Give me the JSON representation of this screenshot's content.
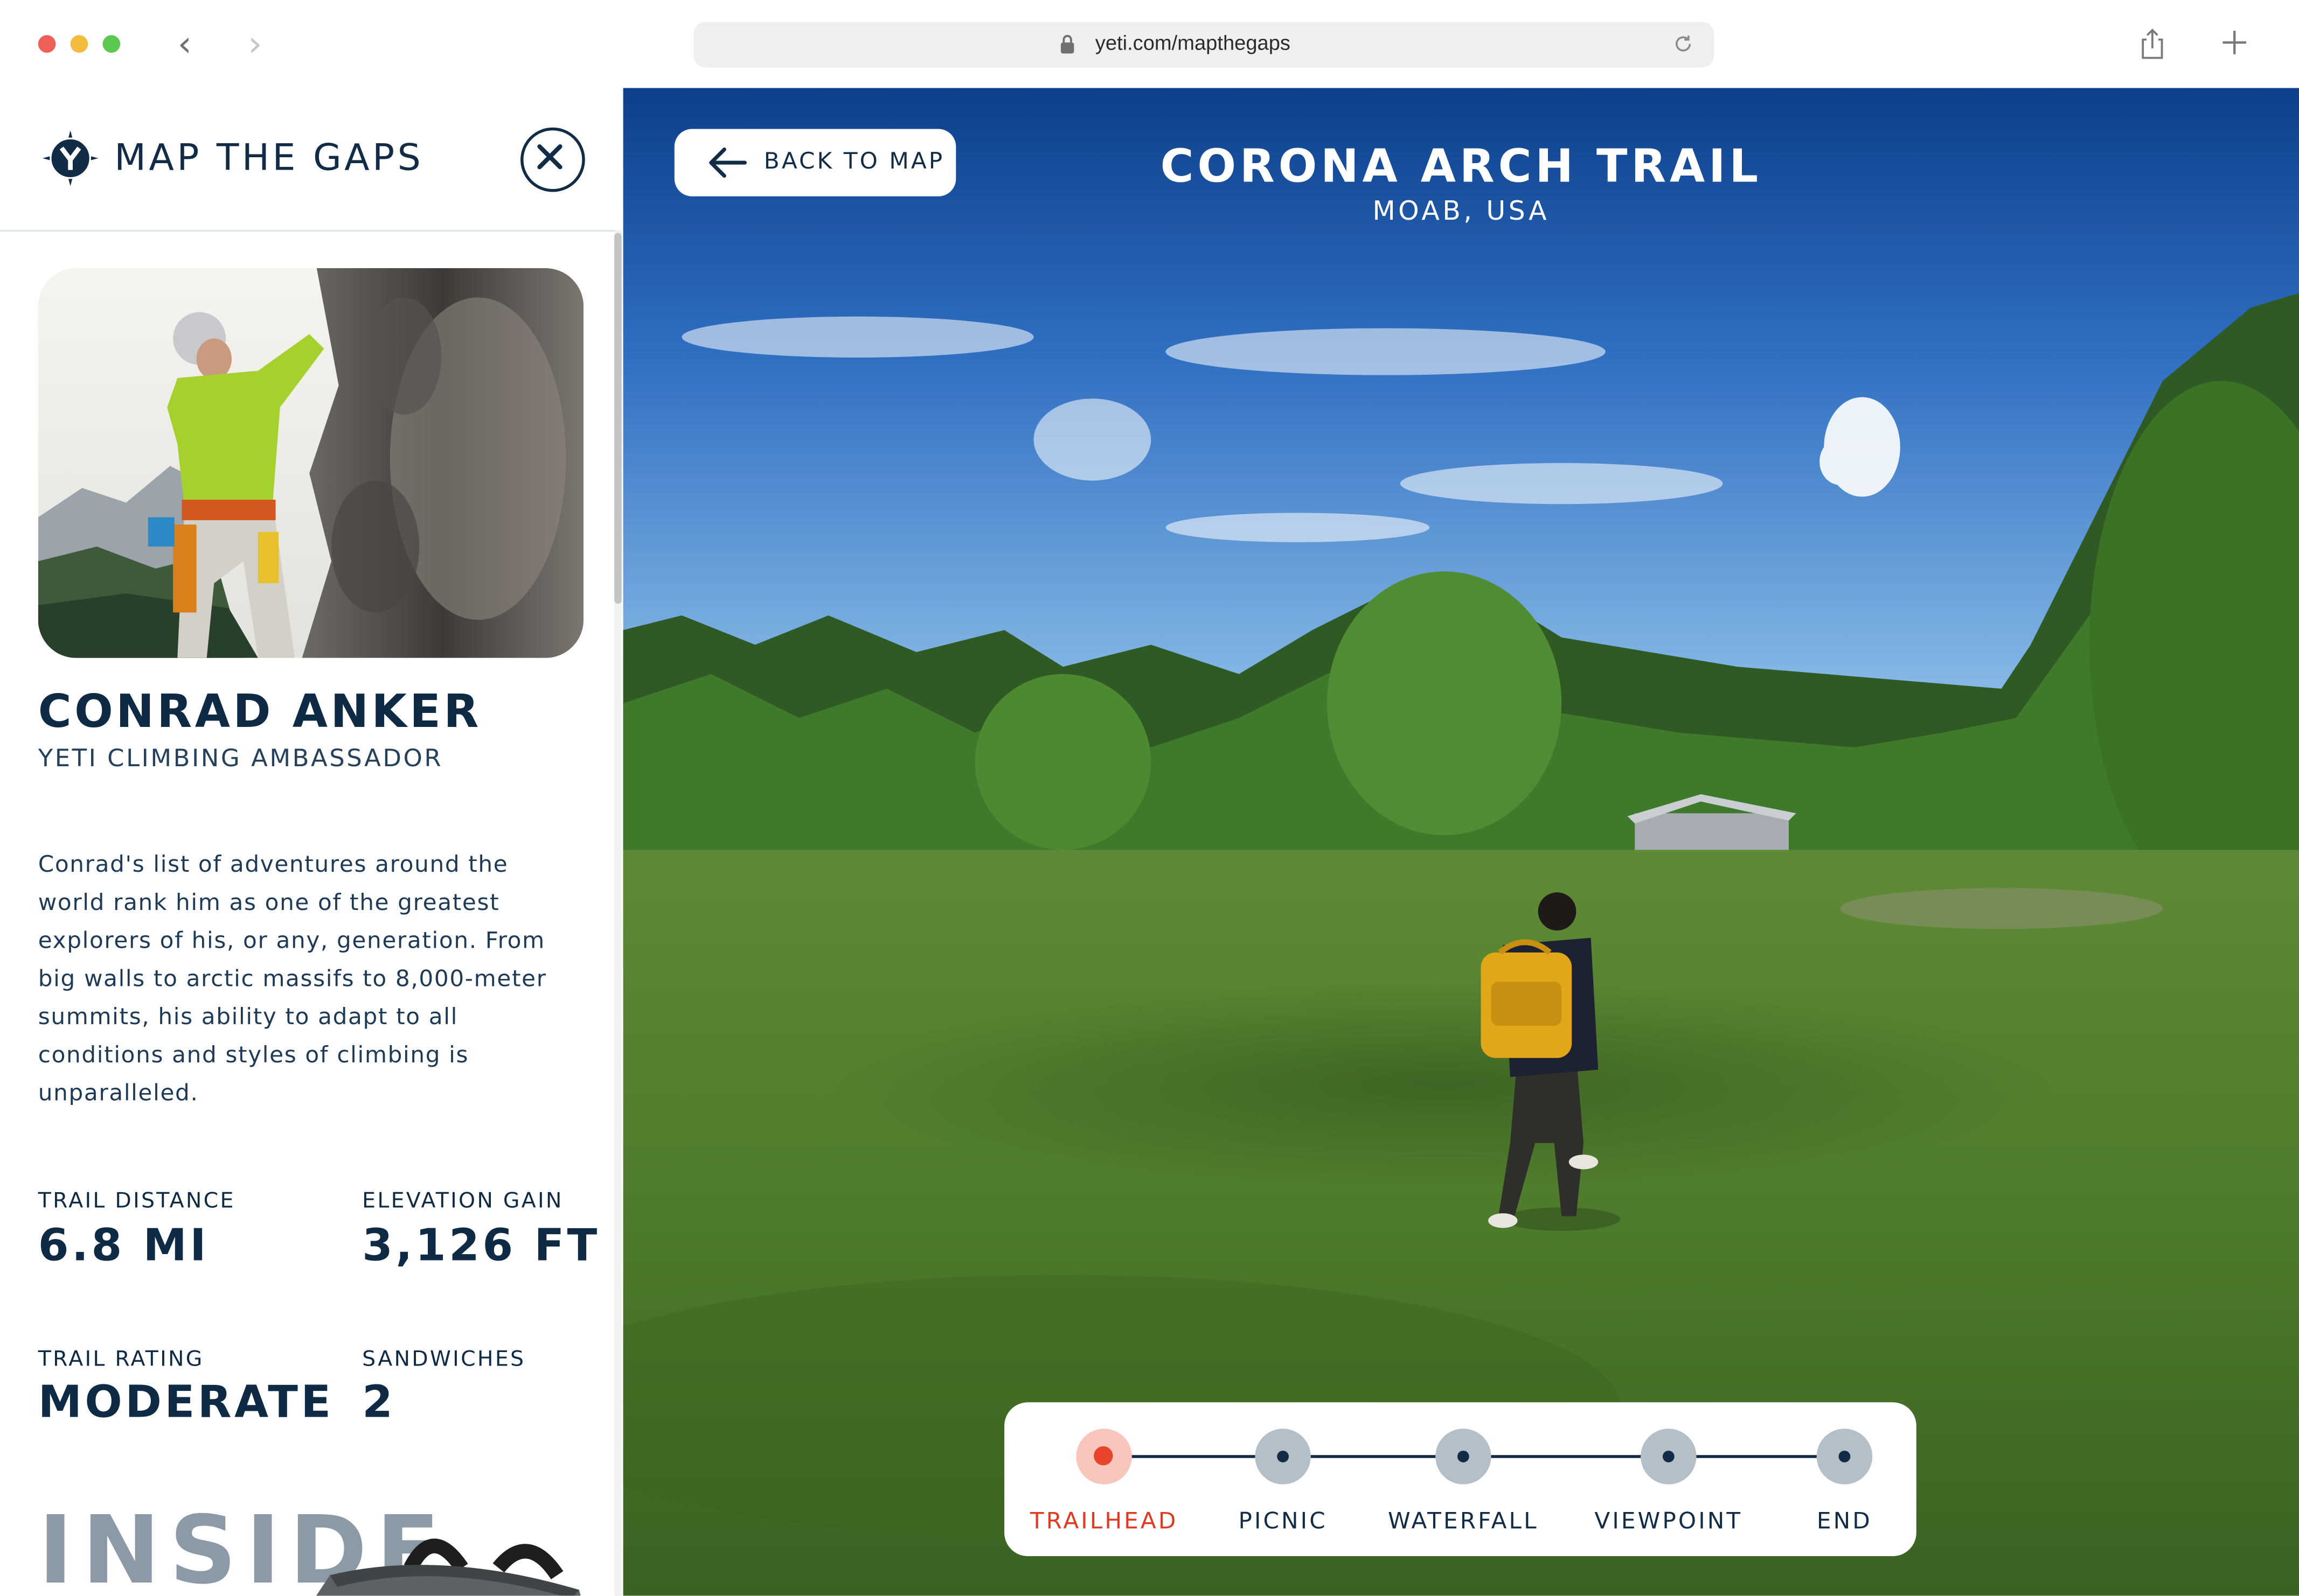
{
  "browser": {
    "url": "yeti.com/mapthegaps"
  },
  "sidebar": {
    "brand_title": "MAP THE GAPS",
    "person_name": "CONRAD ANKER",
    "person_role": "YETI CLIMBING AMBASSADOR",
    "bio": "Conrad's list of adventures around the world rank him as one of the greatest explorers of his, or any, generation. From big walls to arctic massifs to 8,000-meter summits, his ability to adapt to all conditions and styles of climbing is unparalleled.",
    "stats": [
      {
        "label": "TRAIL DISTANCE",
        "value": "6.8 MI"
      },
      {
        "label": "ELEVATION GAIN",
        "value": "3,126 FT"
      },
      {
        "label": "TRAIL RATING",
        "value": "MODERATE"
      },
      {
        "label": "SANDWICHES",
        "value": "2"
      }
    ],
    "inside_heading": "INSIDE"
  },
  "scene": {
    "back_label": "BACK TO MAP",
    "trail_title": "CORONA ARCH TRAIL",
    "trail_location": "MOAB, USA",
    "stops": [
      {
        "label": "TRAILHEAD",
        "active": true
      },
      {
        "label": "PICNIC",
        "active": false
      },
      {
        "label": "WATERFALL",
        "active": false
      },
      {
        "label": "VIEWPOINT",
        "active": false
      },
      {
        "label": "END",
        "active": false
      }
    ]
  },
  "colors": {
    "navy": "#0f2a44",
    "accent_active": "#e8452a",
    "inactive_stop": "#b4bfc8"
  }
}
